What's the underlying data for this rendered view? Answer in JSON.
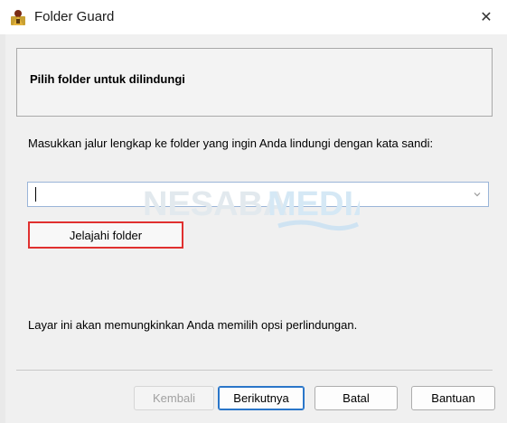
{
  "window": {
    "title": "Folder Guard",
    "close_glyph": "✕",
    "icon": "folder-guard-icon"
  },
  "header": {
    "title": "Pilih folder untuk dilindungi"
  },
  "main": {
    "instruction": "Masukkan jalur lengkap ke folder yang ingin Anda lindungi dengan kata sandi:",
    "path_value": "",
    "browse_label": "Jelajahi folder",
    "info": "Layar ini akan memungkinkan Anda memilih opsi perlindungan."
  },
  "watermark": {
    "text_primary": "NESABA",
    "text_secondary": "MEDIA"
  },
  "footer": {
    "back_label": "Kembali",
    "next_label": "Berikutnya",
    "cancel_label": "Batal",
    "help_label": "Bantuan"
  },
  "colors": {
    "highlight_border": "#e0302f",
    "primary_button_border": "#2a76c9",
    "watermark": "#e2e9ee"
  }
}
